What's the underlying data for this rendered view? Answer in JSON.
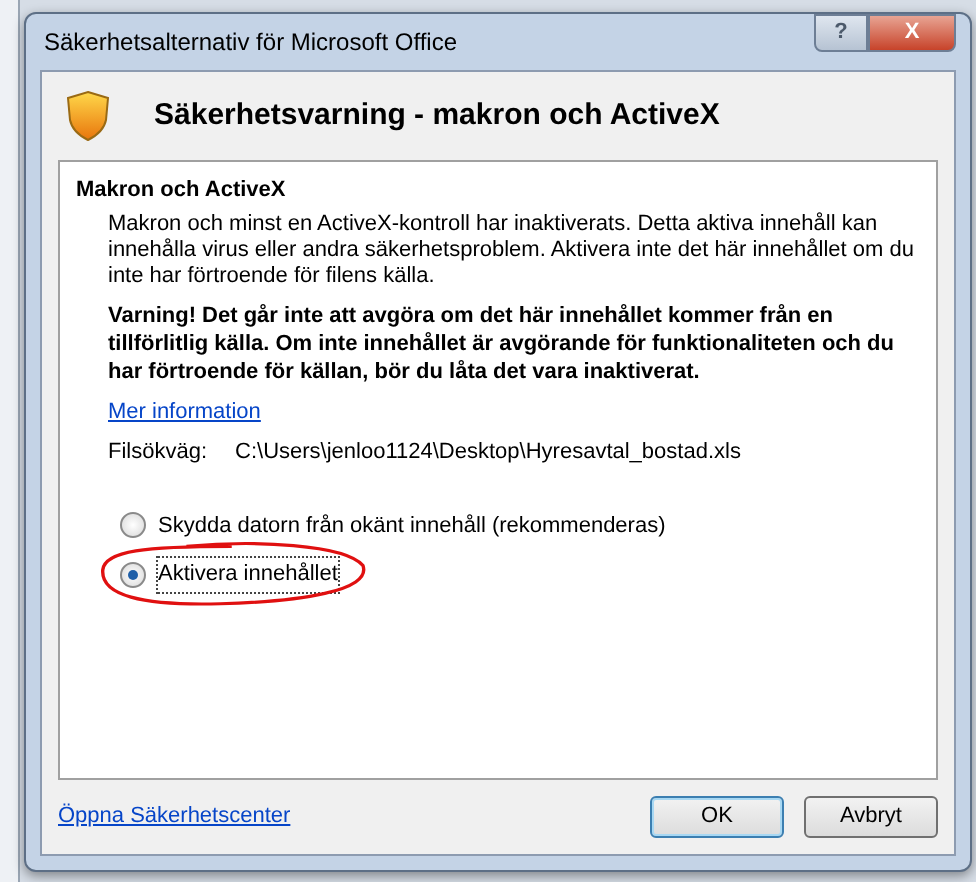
{
  "window": {
    "title": "Säkerhetsalternativ för Microsoft Office",
    "controls": [
      "?",
      "X"
    ]
  },
  "header": {
    "title": "Säkerhetsvarning - makron och ActiveX"
  },
  "section": {
    "title": "Makron och ActiveX",
    "description": "Makron och minst en ActiveX-kontroll har inaktiverats. Detta aktiva innehåll kan innehålla virus eller andra säkerhetsproblem. Aktivera inte det här innehållet om du inte har förtroende för filens källa.",
    "warning": "Varning! Det går inte att avgöra om det här innehållet kommer från en tillförlitlig källa. Om inte innehållet är avgörande för funktionaliteten och du har förtroende för källan, bör du låta det vara inaktiverat.",
    "more_info_link": "Mer information",
    "file_path_label": "Filsökväg:",
    "file_path": "C:\\Users\\jenloo1124\\Desktop\\Hyresavtal_bostad.xls"
  },
  "options": [
    {
      "label": "Skydda datorn från okänt innehåll (rekommenderas)",
      "selected": false,
      "highlighted": false
    },
    {
      "label": "Aktivera innehållet",
      "selected": true,
      "highlighted": true
    }
  ],
  "footer": {
    "link": "Öppna Säkerhetscenter",
    "buttons": [
      {
        "label": "OK",
        "default": true
      },
      {
        "label": "Avbryt",
        "default": false
      }
    ]
  }
}
